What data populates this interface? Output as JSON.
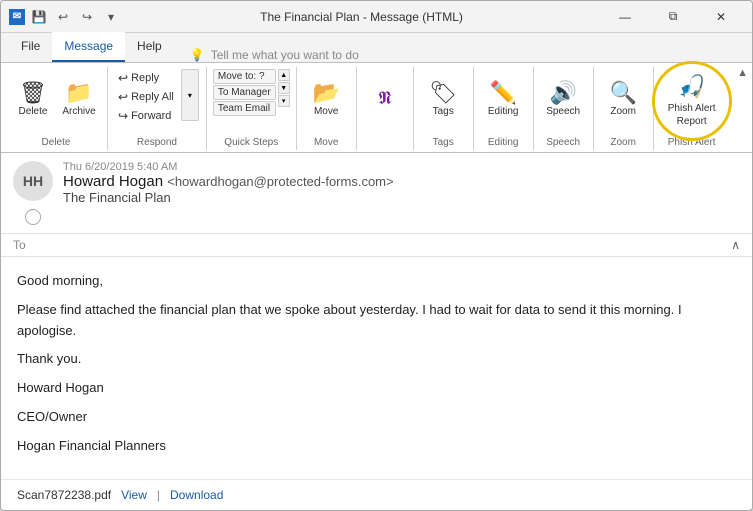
{
  "titleBar": {
    "title": "The Financial Plan - Message (HTML)",
    "saveIcon": "💾",
    "undoIcon": "↩",
    "redoIcon": "↪",
    "moreIcon": "▾"
  },
  "windowControls": {
    "minimize": "—",
    "restore": "⧉",
    "close": "✕"
  },
  "ribbonTabs": [
    {
      "label": "File",
      "active": false
    },
    {
      "label": "Message",
      "active": true
    },
    {
      "label": "Help",
      "active": false
    }
  ],
  "tellMe": {
    "placeholder": "Tell me what you want to do"
  },
  "ribbonGroups": {
    "delete": {
      "label": "Delete",
      "buttons": [
        {
          "label": "Delete",
          "icon": "🗑"
        },
        {
          "label": "Archive",
          "icon": "📁"
        }
      ]
    },
    "respond": {
      "label": "Respond",
      "buttons": [
        {
          "label": "Reply",
          "icon": "↩"
        },
        {
          "label": "Reply All",
          "icon": "↩↩"
        },
        {
          "label": "Forward",
          "icon": "↪"
        }
      ]
    },
    "quickSteps": {
      "label": "Quick Steps",
      "items": [
        "Move to: ?",
        "To Manager",
        "Team Email"
      ]
    },
    "move": {
      "label": "Move",
      "icon": "📂",
      "label2": "Move"
    },
    "tags": {
      "label": "Tags",
      "icon": "🏷"
    },
    "editing": {
      "label": "Editing",
      "icon": "✏️"
    },
    "speech": {
      "label": "Speech",
      "icon": "🔊"
    },
    "zoom": {
      "label": "Zoom",
      "icon": "🔍",
      "groupLabel": "Zoom"
    },
    "phishAlert": {
      "label": "Phish Alert\nReport",
      "groupLabel": "Phish Alert",
      "icon": "🎣"
    }
  },
  "email": {
    "date": "Thu 6/20/2019 5:40 AM",
    "fromInitials": "HH",
    "fromName": "Howard Hogan",
    "fromEmail": "<howardhogan@protected-forms.com>",
    "subject": "The Financial Plan",
    "toLabel": "To",
    "body": [
      "Good morning,",
      "",
      "Please find attached the financial plan that we spoke about yesterday. I had to wait for data to send it this morning. I apologise.",
      "",
      "Thank you.",
      "",
      "Howard Hogan",
      "CEO/Owner",
      "Hogan Financial Planners"
    ],
    "attachment": {
      "filename": "Scan7872238.pdf",
      "viewLabel": "View",
      "separator": "|",
      "downloadLabel": "Download"
    }
  },
  "colors": {
    "accent": "#1a5ba6",
    "phishCircle": "#e8c000",
    "tabActive": "#1a5ba6"
  }
}
